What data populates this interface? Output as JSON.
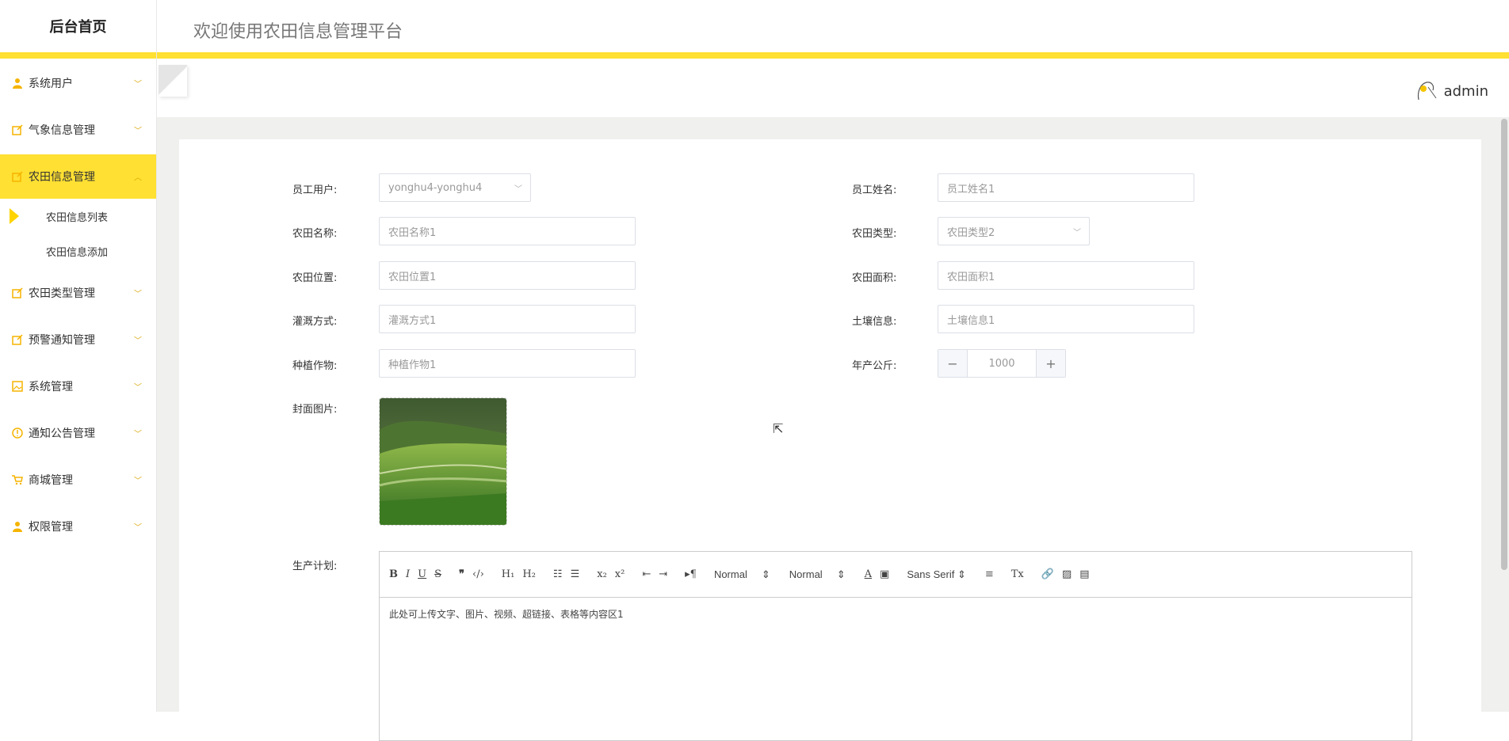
{
  "sidebar": {
    "brand": "后台首页",
    "items": [
      {
        "label": "系统用户",
        "icon": "user-icon"
      },
      {
        "label": "气象信息管理",
        "icon": "edit-icon"
      },
      {
        "label": "农田信息管理",
        "icon": "edit-icon",
        "active": true
      },
      {
        "label": "农田类型管理",
        "icon": "edit-icon"
      },
      {
        "label": "预警通知管理",
        "icon": "edit-icon"
      },
      {
        "label": "系统管理",
        "icon": "image-icon"
      },
      {
        "label": "通知公告管理",
        "icon": "info-icon"
      },
      {
        "label": "商城管理",
        "icon": "cart-icon"
      },
      {
        "label": "权限管理",
        "icon": "user-icon"
      }
    ],
    "subitems": [
      {
        "label": "农田信息列表"
      },
      {
        "label": "农田信息添加"
      }
    ]
  },
  "header": {
    "title": "欢迎使用农田信息管理平台",
    "user": "admin"
  },
  "form": {
    "employee_user_label": "员工用户:",
    "employee_user_value": "yonghu4-yonghu4",
    "employee_name_label": "员工姓名:",
    "employee_name_value": "员工姓名1",
    "field_name_label": "农田名称:",
    "field_name_value": "农田名称1",
    "field_type_label": "农田类型:",
    "field_type_value": "农田类型2",
    "field_location_label": "农田位置:",
    "field_location_value": "农田位置1",
    "field_area_label": "农田面积:",
    "field_area_value": "农田面积1",
    "irrigation_label": "灌溉方式:",
    "irrigation_value": "灌溉方式1",
    "soil_label": "土壤信息:",
    "soil_value": "土壤信息1",
    "crop_label": "种植作物:",
    "crop_value": "种植作物1",
    "annual_label": "年产公斤:",
    "annual_value": "1000",
    "cover_label": "封面图片:",
    "plan_label": "生产计划:",
    "plan_content": "此处可上传文字、图片、视频、超链接、表格等内容区1"
  },
  "editor_toolbar": {
    "header_select": "Normal",
    "size_select": "Normal",
    "font_select": "Sans Serif"
  },
  "colors": {
    "accent": "#ffe033",
    "icon": "#f5b400"
  }
}
